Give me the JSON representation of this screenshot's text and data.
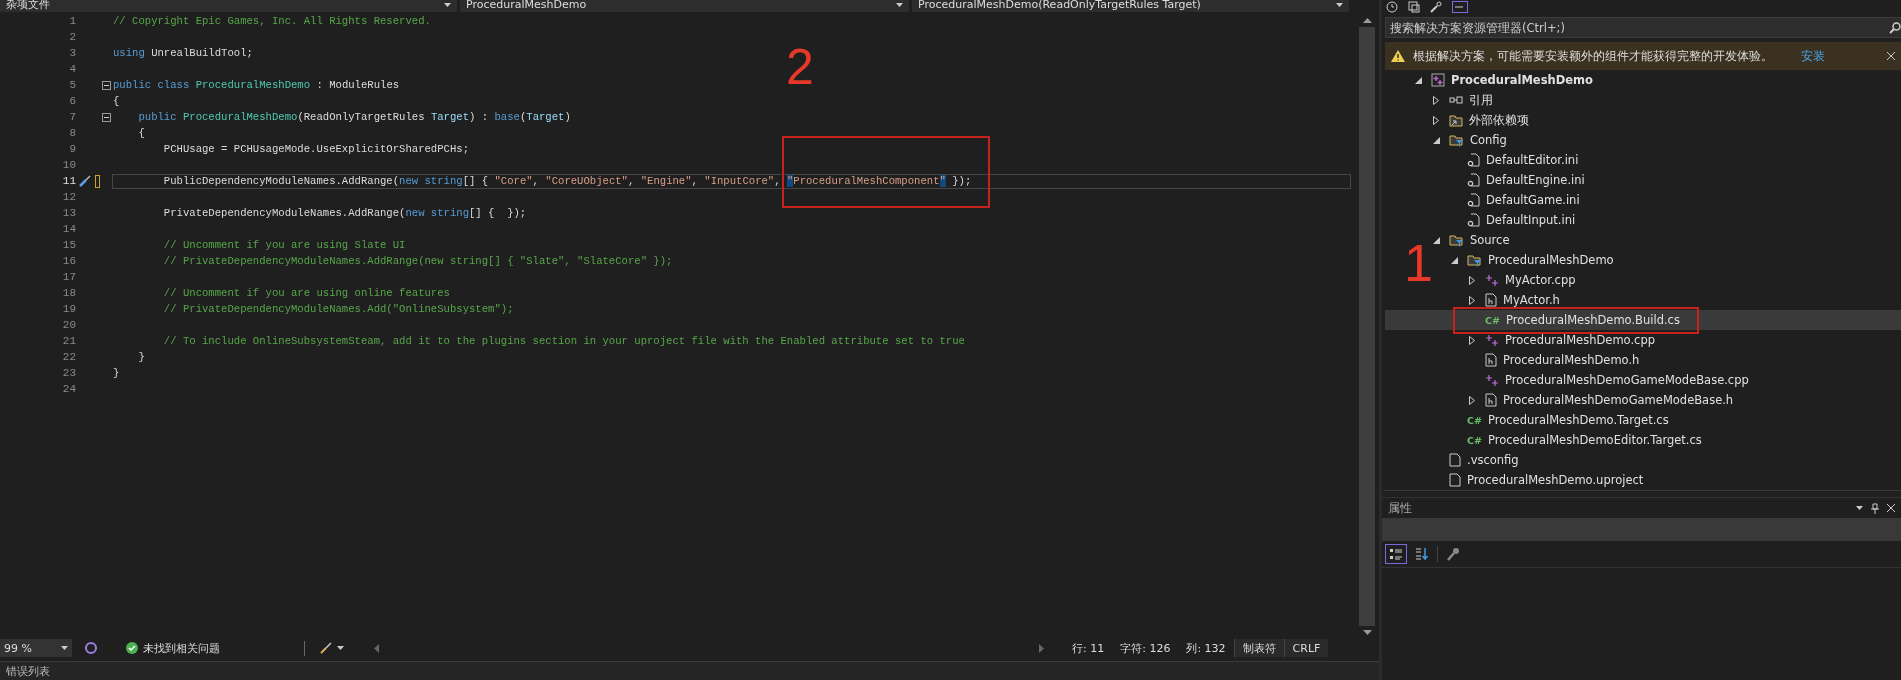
{
  "navigation_bar": [
    "杂项文件",
    "ProceduralMeshDemo",
    "ProceduralMeshDemo(ReadOnlyTargetRules Target)"
  ],
  "editor": {
    "lines": [
      {
        "number": "1",
        "current": false,
        "tokens": [
          {
            "kind": "comment",
            "text": "// Copyright Epic Games, Inc. All Rights Reserved."
          }
        ]
      },
      {
        "number": "2",
        "current": false
      },
      {
        "number": "3",
        "current": false,
        "tokens": [
          {
            "kind": "keyword",
            "text": "using"
          },
          {
            "kind": "plain",
            "text": " UnrealBuildTool;"
          }
        ]
      },
      {
        "number": "4",
        "current": false
      },
      {
        "number": "5",
        "current": false,
        "expanded": true,
        "tokens": [
          {
            "kind": "keyword",
            "text": "public class "
          },
          {
            "kind": "type",
            "text": "ProceduralMeshDemo"
          },
          {
            "kind": "plain",
            "text": " : ModuleRules"
          }
        ]
      },
      {
        "number": "6",
        "current": false,
        "tokens": [
          {
            "kind": "plain",
            "text": "{"
          }
        ]
      },
      {
        "number": "7",
        "current": false,
        "expanded": true,
        "tokens": [
          {
            "kind": "keyword",
            "text": "    public "
          },
          {
            "kind": "type",
            "text": "ProceduralMeshDemo"
          },
          {
            "kind": "plain",
            "text": "(ReadOnlyTargetRules "
          },
          {
            "kind": "param",
            "text": "Target"
          },
          {
            "kind": "plain",
            "text": ") : "
          },
          {
            "kind": "keyword",
            "text": "base"
          },
          {
            "kind": "plain",
            "text": "("
          },
          {
            "kind": "param",
            "text": "Target"
          },
          {
            "kind": "plain",
            "text": ")"
          }
        ]
      },
      {
        "number": "8",
        "current": false,
        "tokens": [
          {
            "kind": "plain",
            "text": "    {"
          }
        ]
      },
      {
        "number": "9",
        "current": false,
        "tokens": [
          {
            "kind": "plain",
            "text": "        PCHUsage = PCHUsageMode.UseExplicitOrSharedPCHs;"
          }
        ]
      },
      {
        "number": "10",
        "current": false
      },
      {
        "number": "11",
        "current": true,
        "tokens": [
          {
            "kind": "plain",
            "text": "        PublicDependencyModuleNames.AddRange("
          },
          {
            "kind": "keyword",
            "text": "new string"
          },
          {
            "kind": "plain",
            "text": "[] { "
          },
          {
            "kind": "string",
            "text": "\"Core\""
          },
          {
            "kind": "plain",
            "text": ", "
          },
          {
            "kind": "string",
            "text": "\"CoreUObject\""
          },
          {
            "kind": "plain",
            "text": ", "
          },
          {
            "kind": "string",
            "text": "\"Engine\""
          },
          {
            "kind": "plain",
            "text": ", "
          },
          {
            "kind": "string",
            "text": "\"InputCore\""
          },
          {
            "kind": "plain",
            "text": ", "
          },
          {
            "kind": "match",
            "text": "\""
          },
          {
            "kind": "string",
            "text": "ProceduralMeshComponent"
          },
          {
            "kind": "match",
            "text": "\""
          },
          {
            "kind": "plain",
            "text": " });"
          }
        ]
      },
      {
        "number": "12",
        "current": false
      },
      {
        "number": "13",
        "current": false,
        "tokens": [
          {
            "kind": "plain",
            "text": "        PrivateDependencyModuleNames.AddRange("
          },
          {
            "kind": "keyword",
            "text": "new string"
          },
          {
            "kind": "plain",
            "text": "[] {  });"
          }
        ]
      },
      {
        "number": "14",
        "current": false
      },
      {
        "number": "15",
        "current": false,
        "tokens": [
          {
            "kind": "comment",
            "text": "        // Uncomment if you are using Slate UI"
          }
        ]
      },
      {
        "number": "16",
        "current": false,
        "tokens": [
          {
            "kind": "comment",
            "text": "        // PrivateDependencyModuleNames.AddRange(new string[] { \"Slate\", \"SlateCore\" });"
          }
        ]
      },
      {
        "number": "17",
        "current": false
      },
      {
        "number": "18",
        "current": false,
        "tokens": [
          {
            "kind": "comment",
            "text": "        // Uncomment if you are using online features"
          }
        ]
      },
      {
        "number": "19",
        "current": false,
        "tokens": [
          {
            "kind": "comment",
            "text": "        // PrivateDependencyModuleNames.Add(\"OnlineSubsystem\");"
          }
        ]
      },
      {
        "number": "20",
        "current": false
      },
      {
        "number": "21",
        "current": false,
        "tokens": [
          {
            "kind": "comment",
            "text": "        // To include OnlineSubsystemSteam, add it to the plugins section in your uproject file with the Enabled attribute set to true"
          }
        ]
      },
      {
        "number": "22",
        "current": false,
        "tokens": [
          {
            "kind": "plain",
            "text": "    }"
          }
        ]
      },
      {
        "number": "23",
        "current": false,
        "tokens": [
          {
            "kind": "plain",
            "text": "}"
          }
        ]
      },
      {
        "number": "24",
        "current": false
      }
    ]
  },
  "annotations": [
    {
      "text": "2"
    },
    {
      "text": "1"
    }
  ],
  "status_bar": {
    "zoom": "99 %",
    "issues": "未找到相关问题",
    "line": "行: 11",
    "char": "字符: 126",
    "column": "列: 132",
    "indent": "制表符",
    "line_ending": "CRLF"
  },
  "bottom_panel": {
    "title": "错误列表"
  },
  "solution_explorer": {
    "search": {
      "placeholder": "搜索解决方案资源管理器(Ctrl+;)"
    },
    "warning": {
      "text": "根据解决方案，可能需要安装额外的组件才能获得完整的开发体验。",
      "action": "安装"
    },
    "tree": [
      {
        "label": "ProceduralMeshDemo",
        "kind": "project",
        "expanded": true,
        "selected": false,
        "children": [
          {
            "label": "引用",
            "kind": "references",
            "expanded": false,
            "selected": false
          },
          {
            "label": "外部依赖项",
            "kind": "external",
            "expanded": false,
            "selected": false
          },
          {
            "label": "Config",
            "kind": "filter",
            "expanded": true,
            "selected": false,
            "children": [
              {
                "label": "DefaultEditor.ini",
                "kind": "ini",
                "selected": false
              },
              {
                "label": "DefaultEngine.ini",
                "kind": "ini",
                "selected": false
              },
              {
                "label": "DefaultGame.ini",
                "kind": "ini",
                "selected": false
              },
              {
                "label": "DefaultInput.ini",
                "kind": "ini",
                "selected": false
              }
            ]
          },
          {
            "label": "Source",
            "kind": "filter",
            "expanded": true,
            "selected": false,
            "children": [
              {
                "label": "ProceduralMeshDemo",
                "kind": "filter",
                "expanded": true,
                "selected": false,
                "children": [
                  {
                    "label": "MyActor.cpp",
                    "kind": "cpp",
                    "expanded": false,
                    "selected": false
                  },
                  {
                    "label": "MyActor.h",
                    "kind": "h",
                    "expanded": false,
                    "selected": false
                  },
                  {
                    "label": "ProceduralMeshDemo.Build.cs",
                    "kind": "cs",
                    "badge": "C#",
                    "selected": true
                  },
                  {
                    "label": "ProceduralMeshDemo.cpp",
                    "kind": "cpp",
                    "expanded": false,
                    "selected": false
                  },
                  {
                    "label": "ProceduralMeshDemo.h",
                    "kind": "h",
                    "selected": false
                  },
                  {
                    "label": "ProceduralMeshDemoGameModeBase.cpp",
                    "kind": "cpp",
                    "selected": false
                  },
                  {
                    "label": "ProceduralMeshDemoGameModeBase.h",
                    "kind": "h",
                    "expanded": false,
                    "selected": false
                  }
                ]
              },
              {
                "label": "ProceduralMeshDemo.Target.cs",
                "kind": "cs",
                "badge": "C#",
                "selected": false
              },
              {
                "label": "ProceduralMeshDemoEditor.Target.cs",
                "kind": "cs",
                "badge": "C#",
                "selected": false
              }
            ]
          },
          {
            "label": ".vsconfig",
            "kind": "file",
            "selected": false
          },
          {
            "label": "ProceduralMeshDemo.uproject",
            "kind": "file",
            "selected": false
          }
        ]
      }
    ]
  },
  "properties": {
    "title": "属性",
    "toolbar": [
      {
        "kind": "categorized",
        "selected": true
      },
      {
        "kind": "alphabetical",
        "selected": false
      },
      {
        "kind": "pages",
        "selected": false
      }
    ]
  }
}
